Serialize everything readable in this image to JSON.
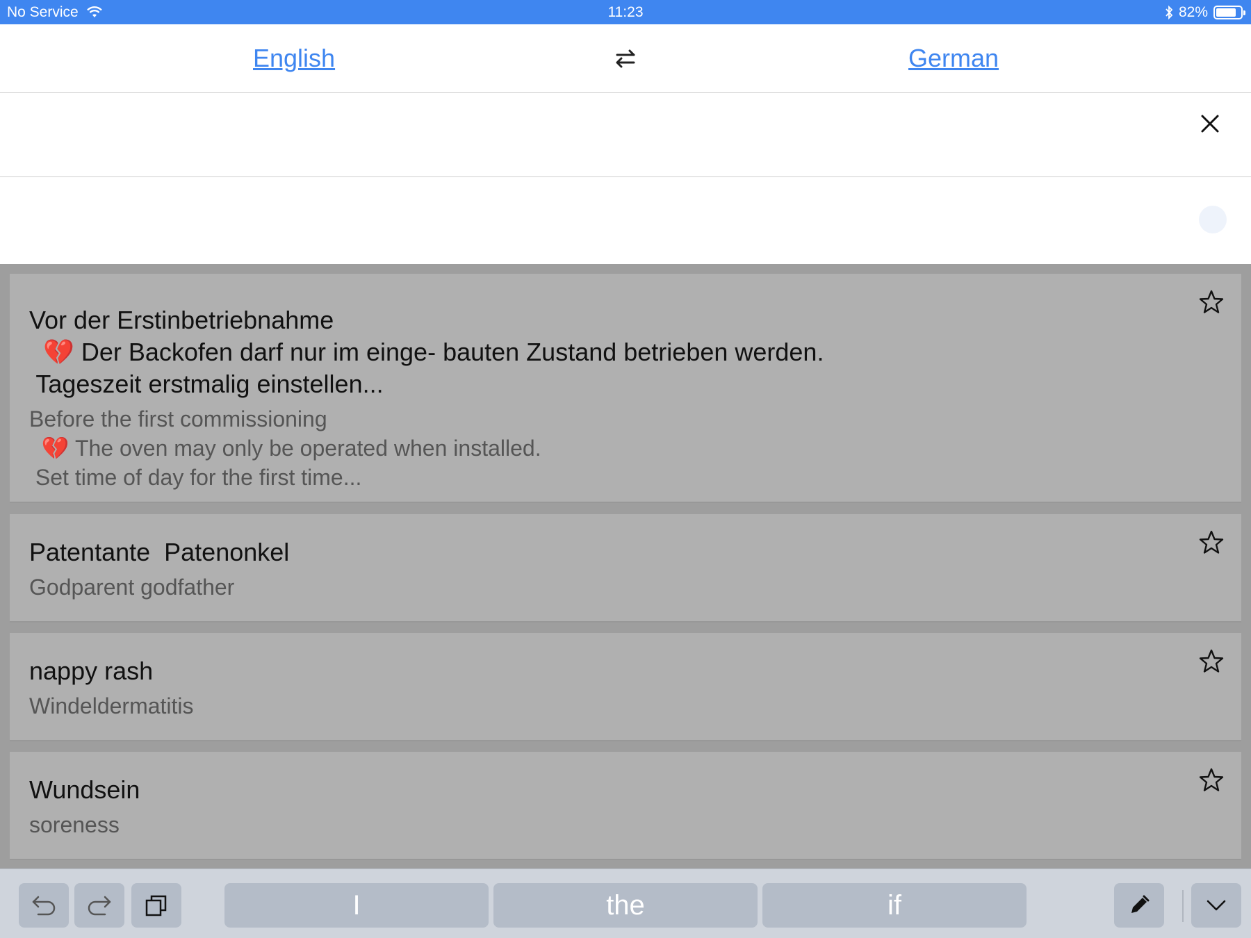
{
  "status_bar": {
    "carrier": "No Service",
    "time": "11:23",
    "battery_text": "82%",
    "battery_level": 0.82
  },
  "languages": {
    "source": "English",
    "target": "German"
  },
  "history": [
    {
      "source": "Vor der Erstinbetriebnahme\n  💔 Der Backofen darf nur im einge- bauten Zustand betrieben werden.\n Tageszeit erstmalig einstellen...",
      "translation": "Before the first commissioning\n  💔 The oven may only be operated when installed.\n Set time of day for the first time..."
    },
    {
      "source": "Patentante  Patenonkel",
      "translation": "Godparent godfather"
    },
    {
      "source": "nappy rash",
      "translation": "Windeldermatitis"
    },
    {
      "source": "Wundsein",
      "translation": "soreness"
    }
  ],
  "keyboard": {
    "suggestions": [
      "I",
      "the",
      "if"
    ]
  },
  "colors": {
    "accent": "#3f86f0",
    "history_bg": "#9e9e9e",
    "card_bg": "#b0b0b0",
    "toolbar_bg": "#cfd4dc"
  },
  "icons": {
    "wifi": "wifi-icon",
    "bluetooth": "bluetooth-icon",
    "battery": "battery-icon",
    "swap": "swap-arrows-icon",
    "close": "close-icon",
    "star": "star-outline-icon",
    "undo": "undo-icon",
    "redo": "redo-icon",
    "paste": "paste-icon",
    "handwriting": "pen-icon",
    "dismiss": "chevron-down-icon"
  }
}
